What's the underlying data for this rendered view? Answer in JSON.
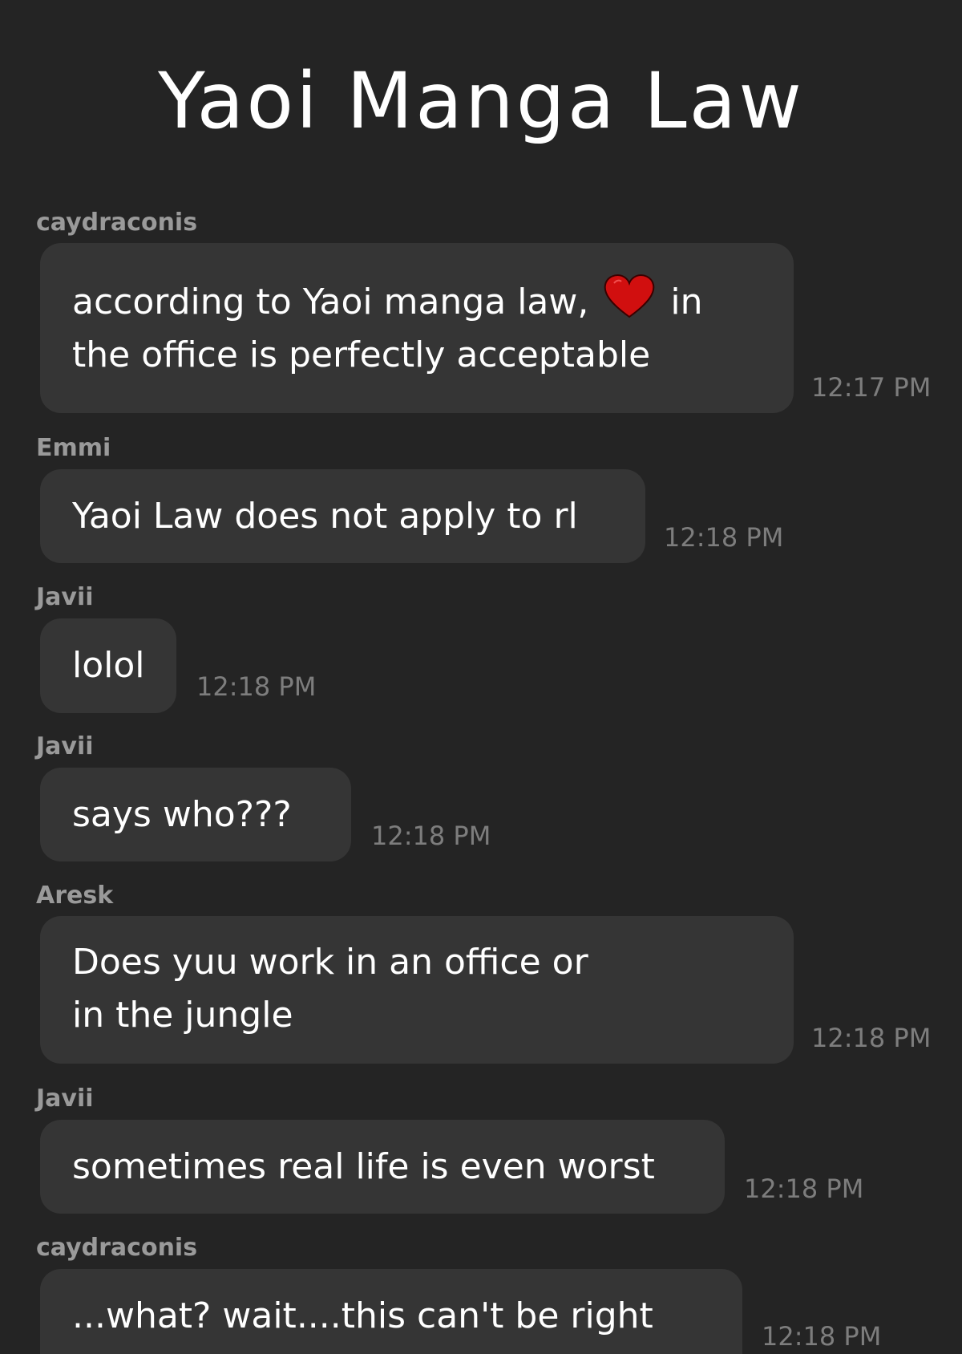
{
  "title": "Yaoi Manga Law",
  "messages": [
    {
      "sender": "caydraconis",
      "lines": [
        "according to Yaoi manga law,",
        "in",
        "the office is perfectly acceptable"
      ],
      "icon": "heart-icon",
      "time": "12:17 PM"
    },
    {
      "sender": "Emmi",
      "lines": [
        "Yaoi Law does not apply to rl"
      ],
      "time": "12:18 PM"
    },
    {
      "sender": "Javii",
      "lines": [
        "lolol"
      ],
      "time": "12:18 PM"
    },
    {
      "sender": "Javii",
      "lines": [
        "says who???"
      ],
      "time": "12:18 PM"
    },
    {
      "sender": "Aresk",
      "lines": [
        "Does yuu work in an office or",
        "in the jungle"
      ],
      "time": "12:18 PM"
    },
    {
      "sender": "Javii",
      "lines": [
        "sometimes real life is even worst"
      ],
      "time": "12:18 PM"
    },
    {
      "sender": "caydraconis",
      "lines": [
        "...what?  wait....this can't be right"
      ],
      "time": "12:18 PM"
    }
  ],
  "colors": {
    "background": "#242424",
    "bubble": "#353535",
    "sender": "#9a9a9a",
    "timestamp": "#7d7d7d",
    "heart": "#d10f0f"
  }
}
